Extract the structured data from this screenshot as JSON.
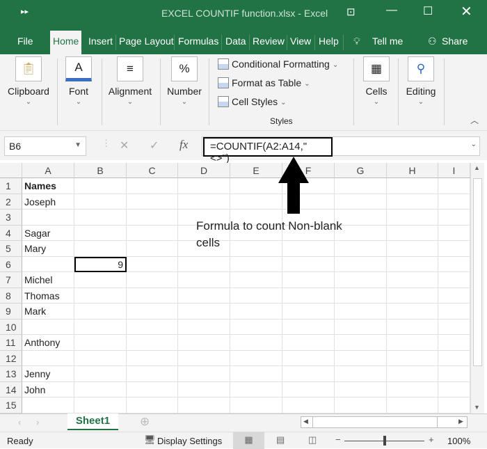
{
  "title": "EXCEL COUNTIF function.xlsx  -  Excel",
  "tabs": [
    "File",
    "Home",
    "Insert",
    "Page Layout",
    "Formulas",
    "Data",
    "Review",
    "View",
    "Help"
  ],
  "tell_me": "Tell me",
  "share": "Share",
  "ribbon": {
    "clipboard": "Clipboard",
    "font": "Font",
    "alignment": "Alignment",
    "number": "Number",
    "conditional_formatting": "Conditional Formatting",
    "format_as_table": "Format as Table",
    "cell_styles": "Cell Styles",
    "styles": "Styles",
    "cells": "Cells",
    "editing": "Editing"
  },
  "name_box": "B6",
  "formula": "=COUNTIF(A2:A14,\"<>\")",
  "columns": [
    "A",
    "B",
    "C",
    "D",
    "E",
    "F",
    "G",
    "H",
    "I"
  ],
  "rows": [
    [
      "Names",
      ""
    ],
    [
      "Joseph",
      ""
    ],
    [
      "",
      ""
    ],
    [
      "Sagar",
      ""
    ],
    [
      "Mary",
      ""
    ],
    [
      "",
      "9"
    ],
    [
      "Michel",
      ""
    ],
    [
      "Thomas",
      ""
    ],
    [
      "Mark",
      ""
    ],
    [
      "",
      ""
    ],
    [
      "Anthony",
      ""
    ],
    [
      "",
      ""
    ],
    [
      "Jenny",
      ""
    ],
    [
      "John",
      ""
    ],
    [
      "",
      ""
    ]
  ],
  "annotation": "Formula to count Non-blank cells",
  "sheet_tab": "Sheet1",
  "status": {
    "ready": "Ready",
    "display_settings": "Display Settings",
    "zoom": "100%"
  },
  "colors": {
    "accent": "#217346"
  }
}
